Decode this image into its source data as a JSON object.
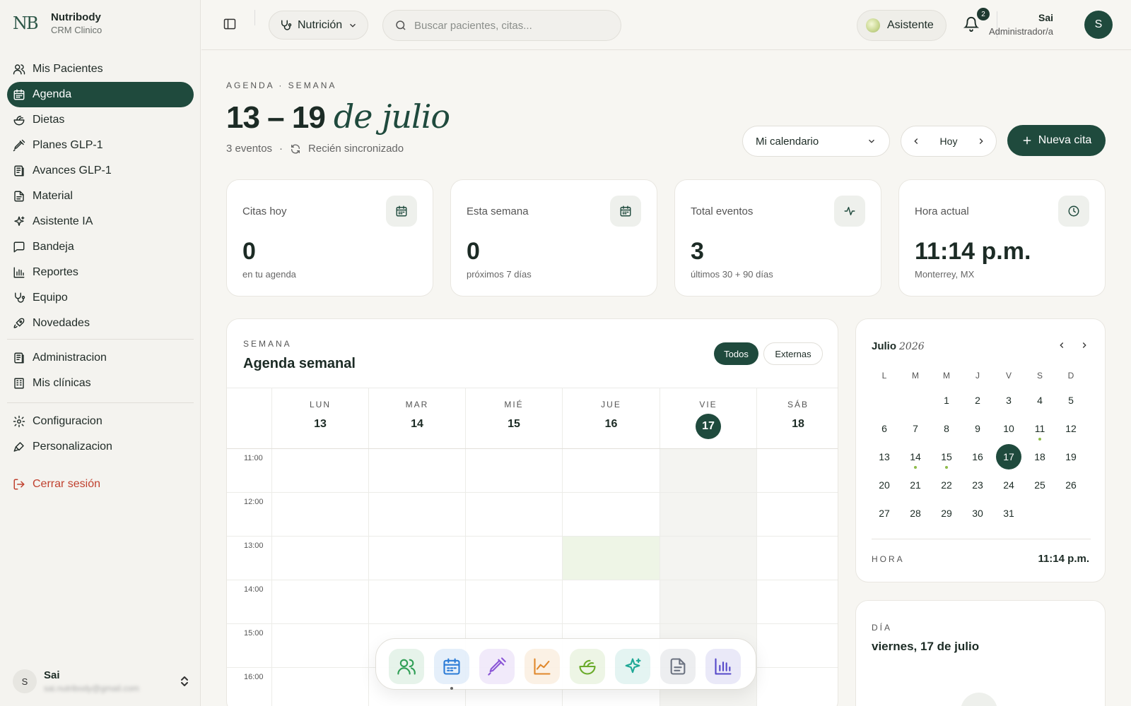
{
  "brand": {
    "logo_text": "NB",
    "name": "Nutribody",
    "subtitle": "CRM Clinico"
  },
  "sidebar": {
    "items": [
      {
        "label": "Mis Pacientes",
        "icon": "users-icon"
      },
      {
        "label": "Agenda",
        "icon": "calendar-icon",
        "active": true
      },
      {
        "label": "Dietas",
        "icon": "salad-icon"
      },
      {
        "label": "Planes GLP-1",
        "icon": "syringe-icon"
      },
      {
        "label": "Avances GLP-1",
        "icon": "book-icon"
      },
      {
        "label": "Material",
        "icon": "document-icon"
      },
      {
        "label": "Asistente IA",
        "icon": "sparkles-icon"
      },
      {
        "label": "Bandeja",
        "icon": "chat-icon"
      },
      {
        "label": "Reportes",
        "icon": "bar-chart-icon"
      },
      {
        "label": "Equipo",
        "icon": "stethoscope-icon"
      },
      {
        "label": "Novedades",
        "icon": "rocket-icon"
      }
    ],
    "admin_items": [
      {
        "label": "Administracion",
        "icon": "book-icon"
      },
      {
        "label": "Mis clínicas",
        "icon": "building-icon"
      }
    ],
    "settings_items": [
      {
        "label": "Configuracion",
        "icon": "gear-icon"
      },
      {
        "label": "Personalizacion",
        "icon": "brush-icon"
      }
    ],
    "logout_label": "Cerrar sesión",
    "user": {
      "initial": "S",
      "name": "Sai",
      "email": "sai.nutribody@gmail.com"
    }
  },
  "topbar": {
    "module": "Nutrición",
    "search_placeholder": "Buscar pacientes, citas...",
    "assistant": "Asistente",
    "notifications": "2",
    "user_name": "Sai",
    "user_role": "Administrador/a",
    "user_initial": "S"
  },
  "header": {
    "eyebrow": "AGENDA · SEMANA",
    "title_range": "13 – 19",
    "title_month": "de julio",
    "event_count": "3 eventos",
    "sync_status": "Recién sincronizado",
    "calendar_select": "Mi calendario",
    "today_label": "Hoy",
    "new_button": "Nueva cita"
  },
  "stats": [
    {
      "label": "Citas hoy",
      "value": "0",
      "sub": "en tu agenda",
      "icon": "calendar-icon"
    },
    {
      "label": "Esta semana",
      "value": "0",
      "sub": "próximos 7 días",
      "icon": "calendar-icon"
    },
    {
      "label": "Total eventos",
      "value": "3",
      "sub": "últimos 30 + 90 días",
      "icon": "pulse-icon"
    },
    {
      "label": "Hora actual",
      "value": "11:14 p.m.",
      "sub": "Monterrey, MX",
      "icon": "clock-icon"
    }
  ],
  "agenda": {
    "eyebrow": "SEMANA",
    "title": "Agenda semanal",
    "filter_all": "Todos",
    "filter_external": "Externas",
    "days": [
      {
        "dow": "LUN",
        "num": "13"
      },
      {
        "dow": "MAR",
        "num": "14"
      },
      {
        "dow": "MIÉ",
        "num": "15"
      },
      {
        "dow": "JUE",
        "num": "16"
      },
      {
        "dow": "VIE",
        "num": "17",
        "today": true
      },
      {
        "dow": "SÁB",
        "num": "18"
      }
    ],
    "hours": [
      "11:00",
      "12:00",
      "13:00",
      "14:00",
      "15:00",
      "16:00"
    ]
  },
  "minical": {
    "month": "Julio",
    "year": "2026",
    "dow": [
      "L",
      "M",
      "M",
      "J",
      "V",
      "S",
      "D"
    ],
    "first_weekday_index": 2,
    "days_in_month": 31,
    "today": 17,
    "event_days": [
      11,
      14,
      15
    ],
    "hour_label": "HORA",
    "hour_value": "11:14 p.m."
  },
  "daycard": {
    "eyebrow": "DÍA",
    "title": "viernes, 17 de julio"
  },
  "dock": [
    {
      "name": "dock-patients-icon",
      "color": "#2f9e55"
    },
    {
      "name": "dock-calendar-icon",
      "color": "#2b7bd6",
      "active": true
    },
    {
      "name": "dock-syringe-icon",
      "color": "#8a55d6"
    },
    {
      "name": "dock-chart-icon",
      "color": "#e0882c"
    },
    {
      "name": "dock-salad-icon",
      "color": "#6aab2a"
    },
    {
      "name": "dock-sparkles-icon",
      "color": "#1fa896"
    },
    {
      "name": "dock-document-icon",
      "color": "#6b7280"
    },
    {
      "name": "dock-reports-icon",
      "color": "#5548c9"
    }
  ],
  "colors": {
    "accent": "#1f4a3d",
    "danger": "#c0412f",
    "event_dot": "#8fbc4b",
    "highlight_cell": "#eef5e6"
  }
}
